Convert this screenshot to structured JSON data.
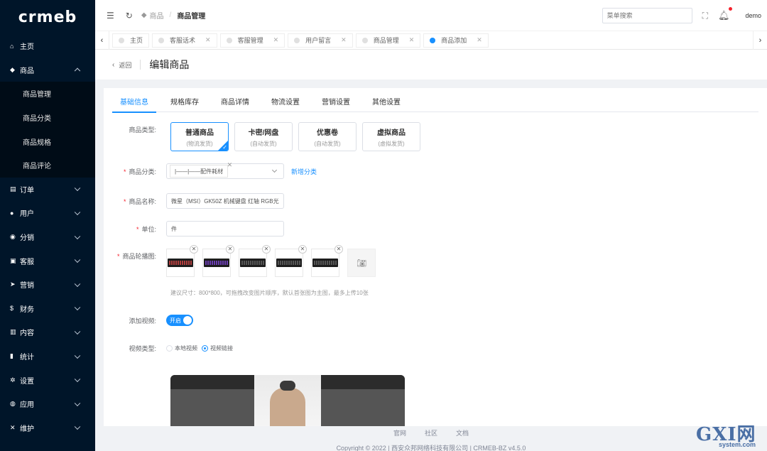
{
  "brand": {
    "logo": "crmeb"
  },
  "sidebar": {
    "items": [
      {
        "label": "主页",
        "icon": "home-icon",
        "glyph": "⌂"
      },
      {
        "label": "商品",
        "icon": "goods-icon",
        "glyph": "◆",
        "expanded": true
      },
      {
        "label": "订单",
        "icon": "cart-icon",
        "glyph": "▤"
      },
      {
        "label": "用户",
        "icon": "user-icon",
        "glyph": "●"
      },
      {
        "label": "分销",
        "icon": "share-icon",
        "glyph": "◉"
      },
      {
        "label": "客服",
        "icon": "chat-icon",
        "glyph": "▣"
      },
      {
        "label": "营销",
        "icon": "send-icon",
        "glyph": "➤"
      },
      {
        "label": "财务",
        "icon": "dollar-icon",
        "glyph": "$"
      },
      {
        "label": "内容",
        "icon": "book-icon",
        "glyph": "▥"
      },
      {
        "label": "统计",
        "icon": "bar-chart-icon",
        "glyph": "▮"
      },
      {
        "label": "设置",
        "icon": "gear-icon",
        "glyph": "✲"
      },
      {
        "label": "应用",
        "icon": "app-icon",
        "glyph": "◍"
      },
      {
        "label": "维护",
        "icon": "wrench-icon",
        "glyph": "✕"
      }
    ],
    "submenu": [
      "商品管理",
      "商品分类",
      "商品规格",
      "商品评论"
    ]
  },
  "header": {
    "breadcrumb": [
      "商品",
      "商品管理"
    ],
    "search_placeholder": "菜单搜索",
    "user": "demo"
  },
  "tabs": [
    {
      "label": "主页",
      "active": false
    },
    {
      "label": "客服话术",
      "active": false
    },
    {
      "label": "客服管理",
      "active": false
    },
    {
      "label": "用户留言",
      "active": false
    },
    {
      "label": "商品管理",
      "active": false
    },
    {
      "label": "商品添加",
      "active": true
    }
  ],
  "page": {
    "back_label": "返回",
    "title": "编辑商品"
  },
  "content_tabs": [
    "基础信息",
    "规格库存",
    "商品详情",
    "物流设置",
    "营销设置",
    "其他设置"
  ],
  "form": {
    "type_label": "商品类型:",
    "types": [
      {
        "title": "普通商品",
        "sub": "(物流发货)",
        "active": true
      },
      {
        "title": "卡密/网盘",
        "sub": "(自动发货)",
        "active": false
      },
      {
        "title": "优惠卷",
        "sub": "(自动发货)",
        "active": false
      },
      {
        "title": "虚拟商品",
        "sub": "(虚拟发货)",
        "active": false
      }
    ],
    "category_label": "商品分类:",
    "category_value": "|——|——配件耗材",
    "add_category": "新增分类",
    "name_label": "商品名称:",
    "name_value": "微星（MSI）GK50Z 机械键盘 红轴 RGB光",
    "unit_label": "单位:",
    "unit_value": "件",
    "images_label": "商品轮播图:",
    "image_hint": "建议尺寸：800*800，可拖拽改变图片顺序，默认首张图为主图，最多上传10张",
    "video_label": "添加视频:",
    "video_switch": "开启",
    "video_type_label": "视频类型:",
    "video_types": [
      {
        "label": "本地视频",
        "checked": false
      },
      {
        "label": "视频链接",
        "checked": true
      }
    ]
  },
  "footer": {
    "links": [
      "官网",
      "社区",
      "文档"
    ],
    "copyright": "Copyright © 2022 | 西安众邦网络科技有限公司 | CRMEB-BZ v4.5.0"
  },
  "watermark": {
    "main": "GXI网",
    "sub": "system.com"
  },
  "colors": {
    "primary": "#1890ff",
    "sidebar": "#001529",
    "danger": "#f5222d"
  }
}
